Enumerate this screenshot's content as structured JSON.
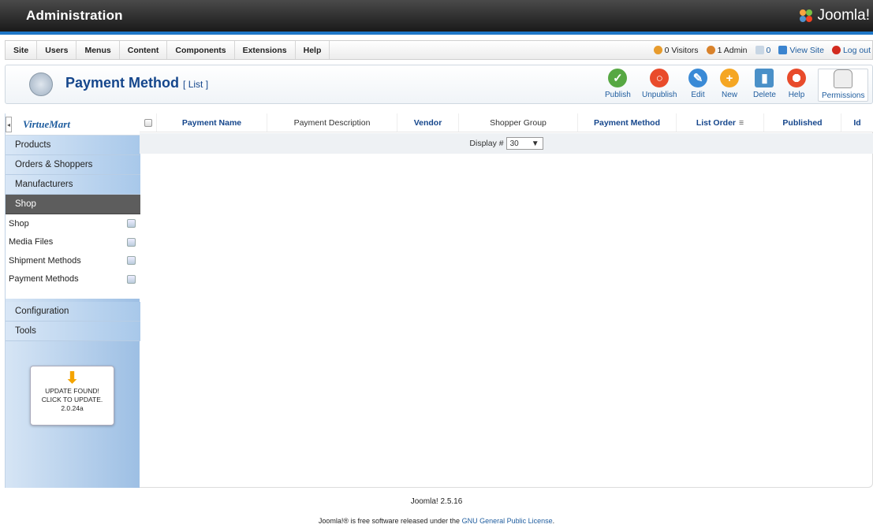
{
  "header": {
    "title": "Administration",
    "logo_text": "Joomla!"
  },
  "menu": {
    "items": [
      "Site",
      "Users",
      "Menus",
      "Content",
      "Components",
      "Extensions",
      "Help"
    ],
    "status": {
      "visitors": "0 Visitors",
      "admin": "1 Admin",
      "messages": "0",
      "view_site": "View Site",
      "logout": "Log out"
    }
  },
  "toolbar": {
    "title": "Payment Method",
    "subtitle": "[ List ]",
    "buttons": {
      "publish": "Publish",
      "unpublish": "Unpublish",
      "edit": "Edit",
      "new": "New",
      "delete": "Delete",
      "help": "Help",
      "permissions": "Permissions"
    }
  },
  "sidebar": {
    "brand": "VirtueMart",
    "items": {
      "products": "Products",
      "orders": "Orders & Shoppers",
      "manufacturers": "Manufacturers",
      "shop": "Shop",
      "configuration": "Configuration",
      "tools": "Tools"
    },
    "sub_items": [
      "Shop",
      "Media Files",
      "Shipment Methods",
      "Payment Methods"
    ],
    "update": {
      "line1": "UPDATE FOUND!",
      "line2": "CLICK TO UPDATE.",
      "version": "2.0.24a"
    }
  },
  "table": {
    "columns": {
      "name": "Payment Name",
      "description": "Payment Description",
      "vendor": "Vendor",
      "shopper_group": "Shopper Group",
      "method": "Payment Method",
      "list_order": "List Order",
      "published": "Published",
      "id": "Id"
    },
    "display_label": "Display #",
    "display_value": "30"
  },
  "footer": {
    "version": "Joomla! 2.5.16",
    "license_prefix": "Joomla!® is free software released under the",
    "license_link": "GNU General Public License",
    "license_suffix": "."
  },
  "colors": {
    "accent": "#1e77c7",
    "title": "#15468c",
    "sidebar_active": "#5d5d5d"
  }
}
